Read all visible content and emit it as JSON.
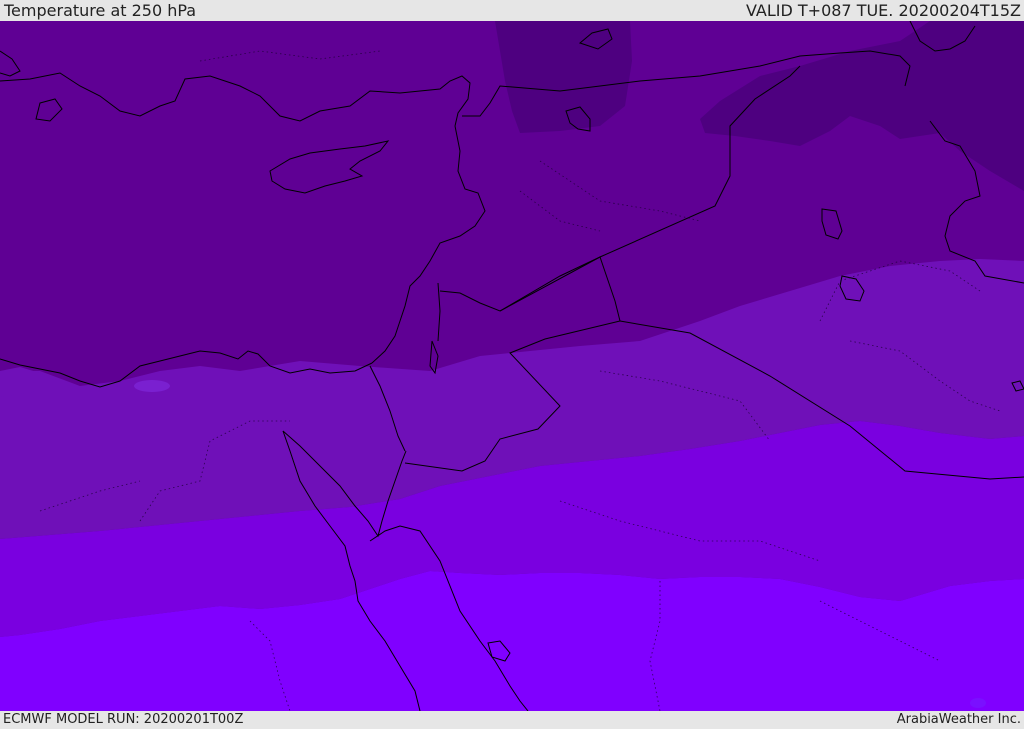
{
  "header": {
    "title": "Temperature at 250 hPa",
    "valid_time": "VALID T+087 TUE. 20200204T15Z"
  },
  "footer": {
    "model_run": "ECMWF MODEL RUN: 20200201T00Z",
    "credit": "ArabiaWeather Inc."
  },
  "map": {
    "region": "Eastern Mediterranean / Levant / Egypt / Arabian Peninsula",
    "colors": {
      "coldest": "#4e0080",
      "cold": "#5f0094",
      "cool": "#6f10b8",
      "mild": "#7a00e0",
      "warm": "#8000ff",
      "coastline": "#000000"
    }
  }
}
